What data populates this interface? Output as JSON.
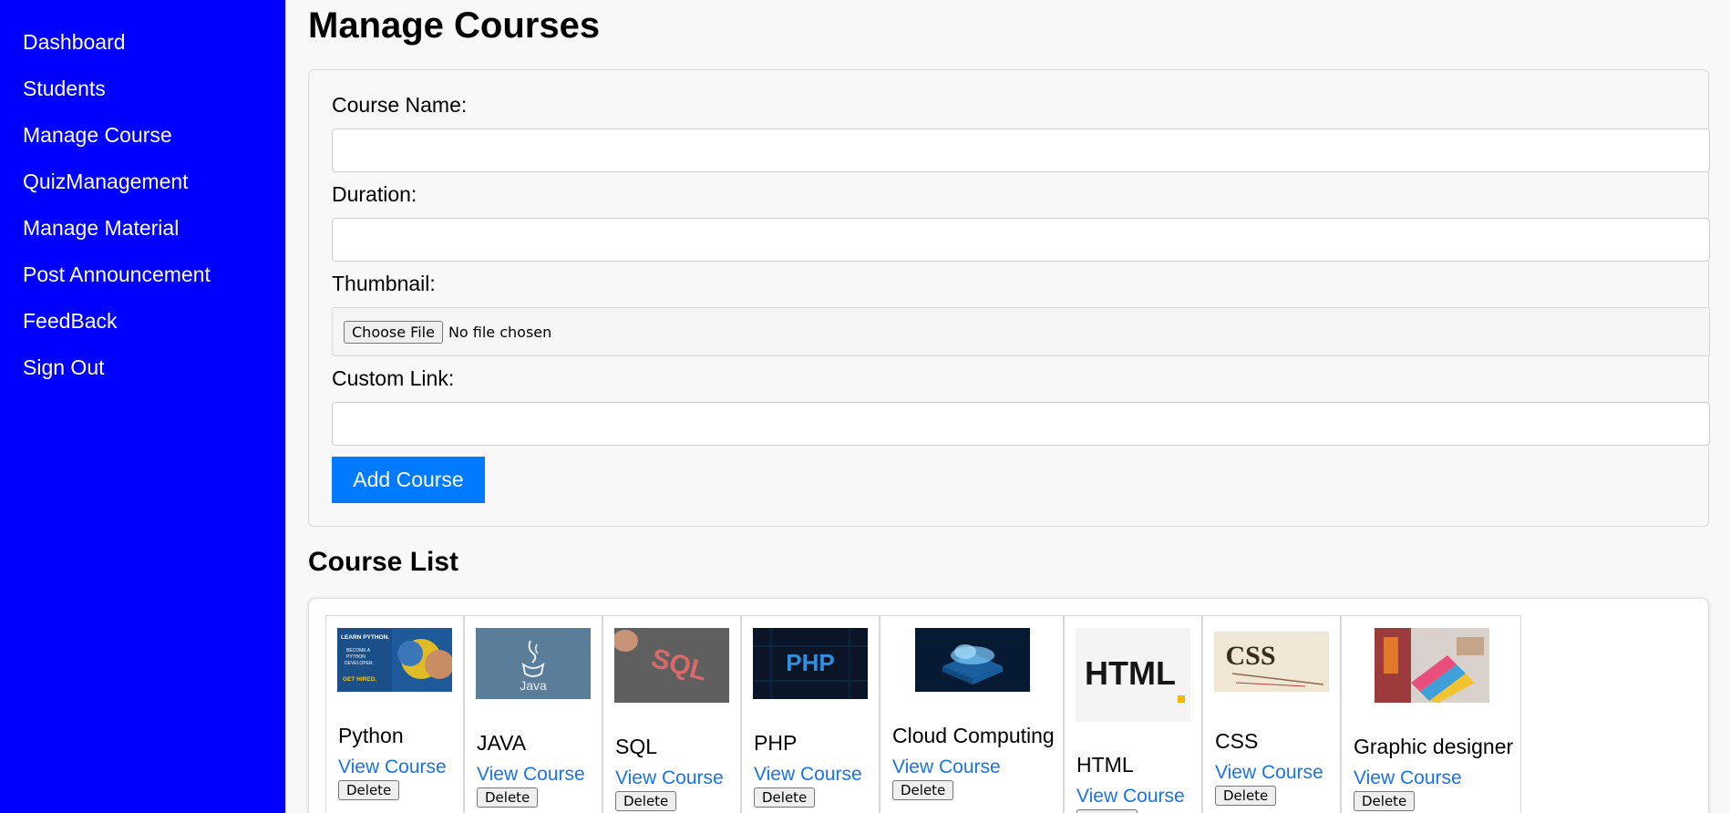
{
  "sidebar": {
    "items": [
      {
        "label": "Dashboard"
      },
      {
        "label": "Students"
      },
      {
        "label": "Manage Course"
      },
      {
        "label": "QuizManagement"
      },
      {
        "label": "Manage Material"
      },
      {
        "label": "Post Announcement"
      },
      {
        "label": "FeedBack"
      },
      {
        "label": "Sign Out"
      }
    ],
    "background_color": "#0000ff"
  },
  "page": {
    "title": "Manage Courses"
  },
  "form": {
    "course_name_label": "Course Name:",
    "course_name_value": "",
    "duration_label": "Duration:",
    "duration_value": "",
    "thumbnail_label": "Thumbnail:",
    "file_button_label": "Choose File",
    "file_status": "No file chosen",
    "custom_link_label": "Custom Link:",
    "custom_link_value": "",
    "submit_label": "Add Course",
    "submit_color": "#007bff"
  },
  "course_list": {
    "title": "Course List",
    "link_label": "View Course",
    "delete_label": "Delete",
    "link_color": "#1a73e8",
    "courses": [
      {
        "name": "Python",
        "thumbnail_icon": "python-thumbnail",
        "thumbnail_text": "LEARN PYTHON. BECOME A PYTHON DEVELOPER. GET HIRED."
      },
      {
        "name": "JAVA",
        "thumbnail_icon": "java-thumbnail",
        "thumbnail_text": "Java"
      },
      {
        "name": "SQL",
        "thumbnail_icon": "sql-thumbnail",
        "thumbnail_text": "SQL"
      },
      {
        "name": "PHP",
        "thumbnail_icon": "php-thumbnail",
        "thumbnail_text": "PHP"
      },
      {
        "name": "Cloud Computing",
        "thumbnail_icon": "cloud-computing-thumbnail",
        "thumbnail_text": ""
      },
      {
        "name": "HTML",
        "thumbnail_icon": "html-thumbnail",
        "thumbnail_text": "HTML"
      },
      {
        "name": "CSS",
        "thumbnail_icon": "css-thumbnail",
        "thumbnail_text": "CSS"
      },
      {
        "name": "Graphic designer",
        "thumbnail_icon": "graphic-design-thumbnail",
        "thumbnail_text": ""
      }
    ]
  }
}
